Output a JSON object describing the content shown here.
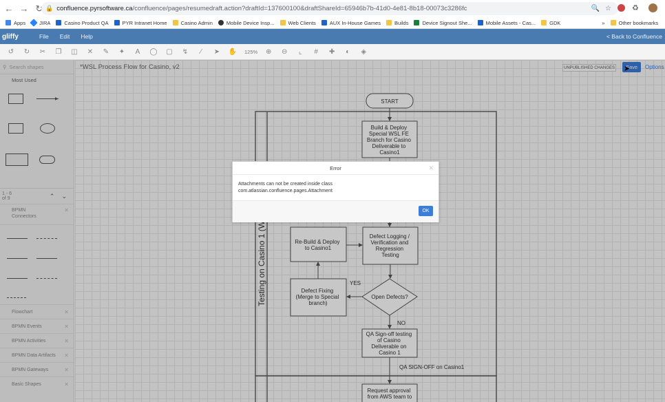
{
  "browser": {
    "url_host": "confluence.pyrsoftware.ca",
    "url_path": "/confluence/pages/resumedraft.action?draftId=137600100&draftShareId=65946b7b-41d0-4e81-8b18-00073c3286fc"
  },
  "bookmarks": [
    {
      "label": "Apps",
      "color": "#4285f4"
    },
    {
      "label": "JIRA",
      "color": "#2684ff"
    },
    {
      "label": "Casino Product QA",
      "color": "#1f62c8"
    },
    {
      "label": "PYR Intranet Home",
      "color": "#1f62c8"
    },
    {
      "label": "Casino Admin",
      "color": "#f4c542"
    },
    {
      "label": "Mobile Device Insp...",
      "color": "#333333"
    },
    {
      "label": "Web Clients",
      "color": "#f4c542"
    },
    {
      "label": "AUX In-House Games",
      "color": "#1f62c8"
    },
    {
      "label": "Builds",
      "color": "#f4c542"
    },
    {
      "label": "Device Signout She...",
      "color": "#188038"
    },
    {
      "label": "Mobile Assets - Cas...",
      "color": "#1f62c8"
    },
    {
      "label": "GDK",
      "color": "#f4c542"
    },
    {
      "label": "»",
      "color": ""
    },
    {
      "label": "Other bookmarks",
      "color": "#f4c542"
    }
  ],
  "app": {
    "logo": "gliffy",
    "menu": [
      "File",
      "Edit",
      "Help"
    ],
    "back_link": "< Back to Confluence"
  },
  "toolbar": {
    "zoom": "125%"
  },
  "doc": {
    "title": "*WSL Process Flow for Casino, v2",
    "unpublished": "UNPUBLISHED CHANGES",
    "save": "Save",
    "options": "Options"
  },
  "left_panel": {
    "search_placeholder": "Search shapes",
    "most_used": "Most Used",
    "pager": "1 - 6 of 9",
    "libraries": [
      "BPMN Connectors",
      "Flowchart",
      "BPMN Events",
      "BPMN Activities",
      "BPMN Data Artifacts",
      "BPMN Gateways",
      "Basic Shapes"
    ]
  },
  "flow": {
    "start": "START",
    "build_deploy": [
      "Build & Deploy",
      "Special WSL FE",
      "Branch for Casino",
      "Deliverable to",
      "Casino1"
    ],
    "lane": "Testing on Casino 1 (W",
    "rebuild": [
      "Re-Build & Deploy",
      "to Casino1"
    ],
    "defect_logging": [
      "Defect Logging /",
      "Verification and",
      "Regression",
      "Testing"
    ],
    "defect_fixing": [
      "Defect Fixing",
      "(Merge to Special",
      "branch)"
    ],
    "open_defects": "Open Defects?",
    "yes": "YES",
    "no": "NO",
    "qa_signoff": [
      "QA Sign-off testing",
      "of Casino",
      "Deliverable on",
      "Casino 1"
    ],
    "qa_signoff_label": "QA SIGN-OFF on Casino1",
    "request": [
      "Request approval",
      "from AWS team to"
    ]
  },
  "dialog": {
    "title": "Error",
    "message_line1": "Attachments can not be created inside class",
    "message_line2": "com.atlassian.confluence.pages.Attachment",
    "ok": "OK"
  }
}
